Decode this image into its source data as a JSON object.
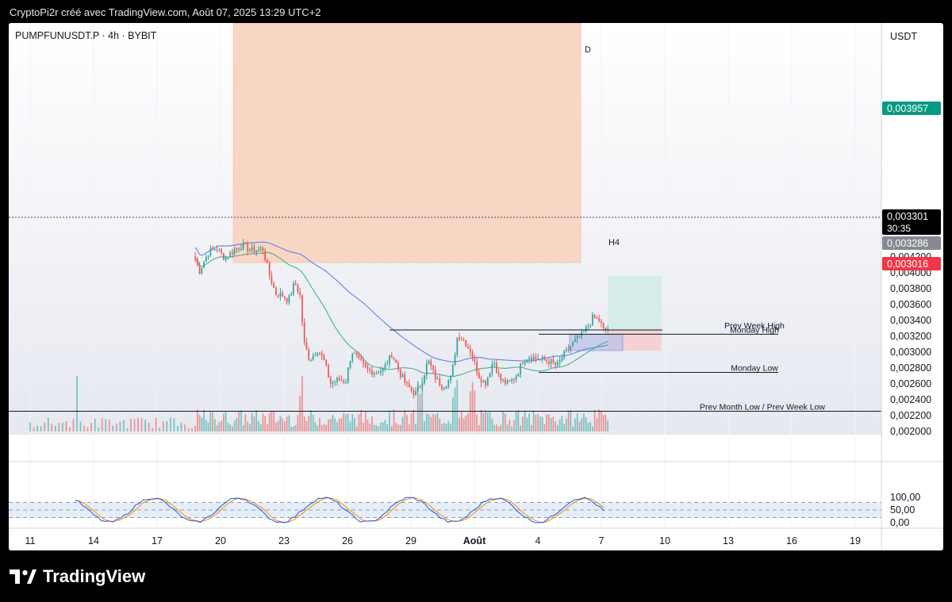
{
  "header": {
    "title": "CryptoPi2r créé avec TradingView.com, Août 07, 2025 13:29 UTC+2"
  },
  "symbol": "PUMPFUNUSDT.P · 4h · BYBIT",
  "footer": {
    "brand": "TradingView"
  },
  "colors": {
    "up": "#26a69a",
    "down": "#ef5350",
    "ma_fast": "#4caf8f",
    "ma_slow": "#5b84e8",
    "supply_zone": "#f9d6c4",
    "target_zone": "#d6ece8",
    "stop_zone": "#f3d2d6",
    "h4_box": "#b9bfe8"
  },
  "chart_data": [
    {
      "type": "candlestick",
      "title": "PUMPFUNUSDT.P · 4h · BYBIT",
      "currency": "USDT",
      "ylim": [
        0.00198,
        0.00434
      ],
      "y_ticks": [
        "0,004200",
        "0,004000",
        "0,003800",
        "0,003600",
        "0,003400",
        "0,003200",
        "0,003000",
        "0,002800",
        "0,002600",
        "0,002400",
        "0,002200",
        "0,002000"
      ],
      "x_ticks": [
        "11",
        "14",
        "17",
        "20",
        "23",
        "26",
        "29",
        "Août",
        "4",
        "7",
        "10",
        "13",
        "16",
        "19"
      ],
      "price_path": [
        [
          18.8,
          0.00418
        ],
        [
          19.0,
          0.00402
        ],
        [
          19.4,
          0.00425
        ],
        [
          19.8,
          0.00432
        ],
        [
          20.2,
          0.00418
        ],
        [
          20.6,
          0.00428
        ],
        [
          21.0,
          0.00435
        ],
        [
          21.5,
          0.00428
        ],
        [
          22.0,
          0.0043
        ],
        [
          22.3,
          0.00398
        ],
        [
          22.6,
          0.00374
        ],
        [
          22.9,
          0.00372
        ],
        [
          23.2,
          0.00365
        ],
        [
          23.5,
          0.00388
        ],
        [
          23.8,
          0.00368
        ],
        [
          23.9,
          0.00315
        ],
        [
          24.2,
          0.0029
        ],
        [
          24.6,
          0.00304
        ],
        [
          24.9,
          0.00288
        ],
        [
          25.2,
          0.0026
        ],
        [
          25.6,
          0.00266
        ],
        [
          25.9,
          0.00262
        ],
        [
          26.2,
          0.00302
        ],
        [
          26.5,
          0.0029
        ],
        [
          26.9,
          0.00278
        ],
        [
          27.3,
          0.00275
        ],
        [
          27.7,
          0.00278
        ],
        [
          28.1,
          0.00298
        ],
        [
          28.5,
          0.00272
        ],
        [
          28.8,
          0.00258
        ],
        [
          29.2,
          0.00247
        ],
        [
          29.5,
          0.00262
        ],
        [
          29.8,
          0.0029
        ],
        [
          30.2,
          0.00265
        ],
        [
          30.5,
          0.00256
        ],
        [
          30.9,
          0.00268
        ],
        [
          31.2,
          0.00322
        ],
        [
          31.5,
          0.00315
        ],
        [
          31.8,
          0.00302
        ],
        [
          32.2,
          0.0027
        ],
        [
          32.5,
          0.0026
        ],
        [
          32.9,
          0.0029
        ],
        [
          33.2,
          0.00265
        ],
        [
          33.6,
          0.0026
        ],
        [
          34.0,
          0.00272
        ],
        [
          34.3,
          0.0029
        ],
        [
          34.6,
          0.00295
        ],
        [
          35.0,
          0.00292
        ],
        [
          35.3,
          0.0029
        ],
        [
          35.6,
          0.00288
        ],
        [
          35.9,
          0.00282
        ],
        [
          36.2,
          0.00296
        ],
        [
          36.5,
          0.00306
        ],
        [
          36.8,
          0.00316
        ],
        [
          37.1,
          0.00322
        ],
        [
          37.4,
          0.00334
        ],
        [
          37.6,
          0.00344
        ],
        [
          37.9,
          0.0034
        ],
        [
          38.1,
          0.00328
        ],
        [
          38.3,
          0.0033
        ]
      ],
      "volume_spike_days": [
        13.2,
        23.8,
        29.4,
        31.1,
        31.9
      ],
      "levels": [
        {
          "label": "Prev Week High",
          "value": 0.00328
        },
        {
          "label": "Monday High",
          "value": 0.003226
        },
        {
          "label": "Monday Low",
          "value": 0.002745
        },
        {
          "label": "Prev Month Low / Prev Week Low",
          "value": 0.002255
        }
      ],
      "zone_labels": {
        "supply": "D",
        "h4": "H4"
      },
      "price_badges": [
        {
          "label": "0,003957",
          "color": "#089981"
        },
        {
          "label": "0,003301",
          "color": "#000000",
          "sub": "30:35"
        },
        {
          "label": "0,003286",
          "color": "#868993"
        },
        {
          "label": "0,003016",
          "color": "#f23645"
        }
      ]
    },
    {
      "type": "line",
      "name": "Stochastic RSI",
      "ylim": [
        0,
        100
      ],
      "y_ticks": [
        "100,00",
        "50,00",
        "0,00"
      ],
      "bands": [
        80,
        50,
        20
      ]
    }
  ]
}
